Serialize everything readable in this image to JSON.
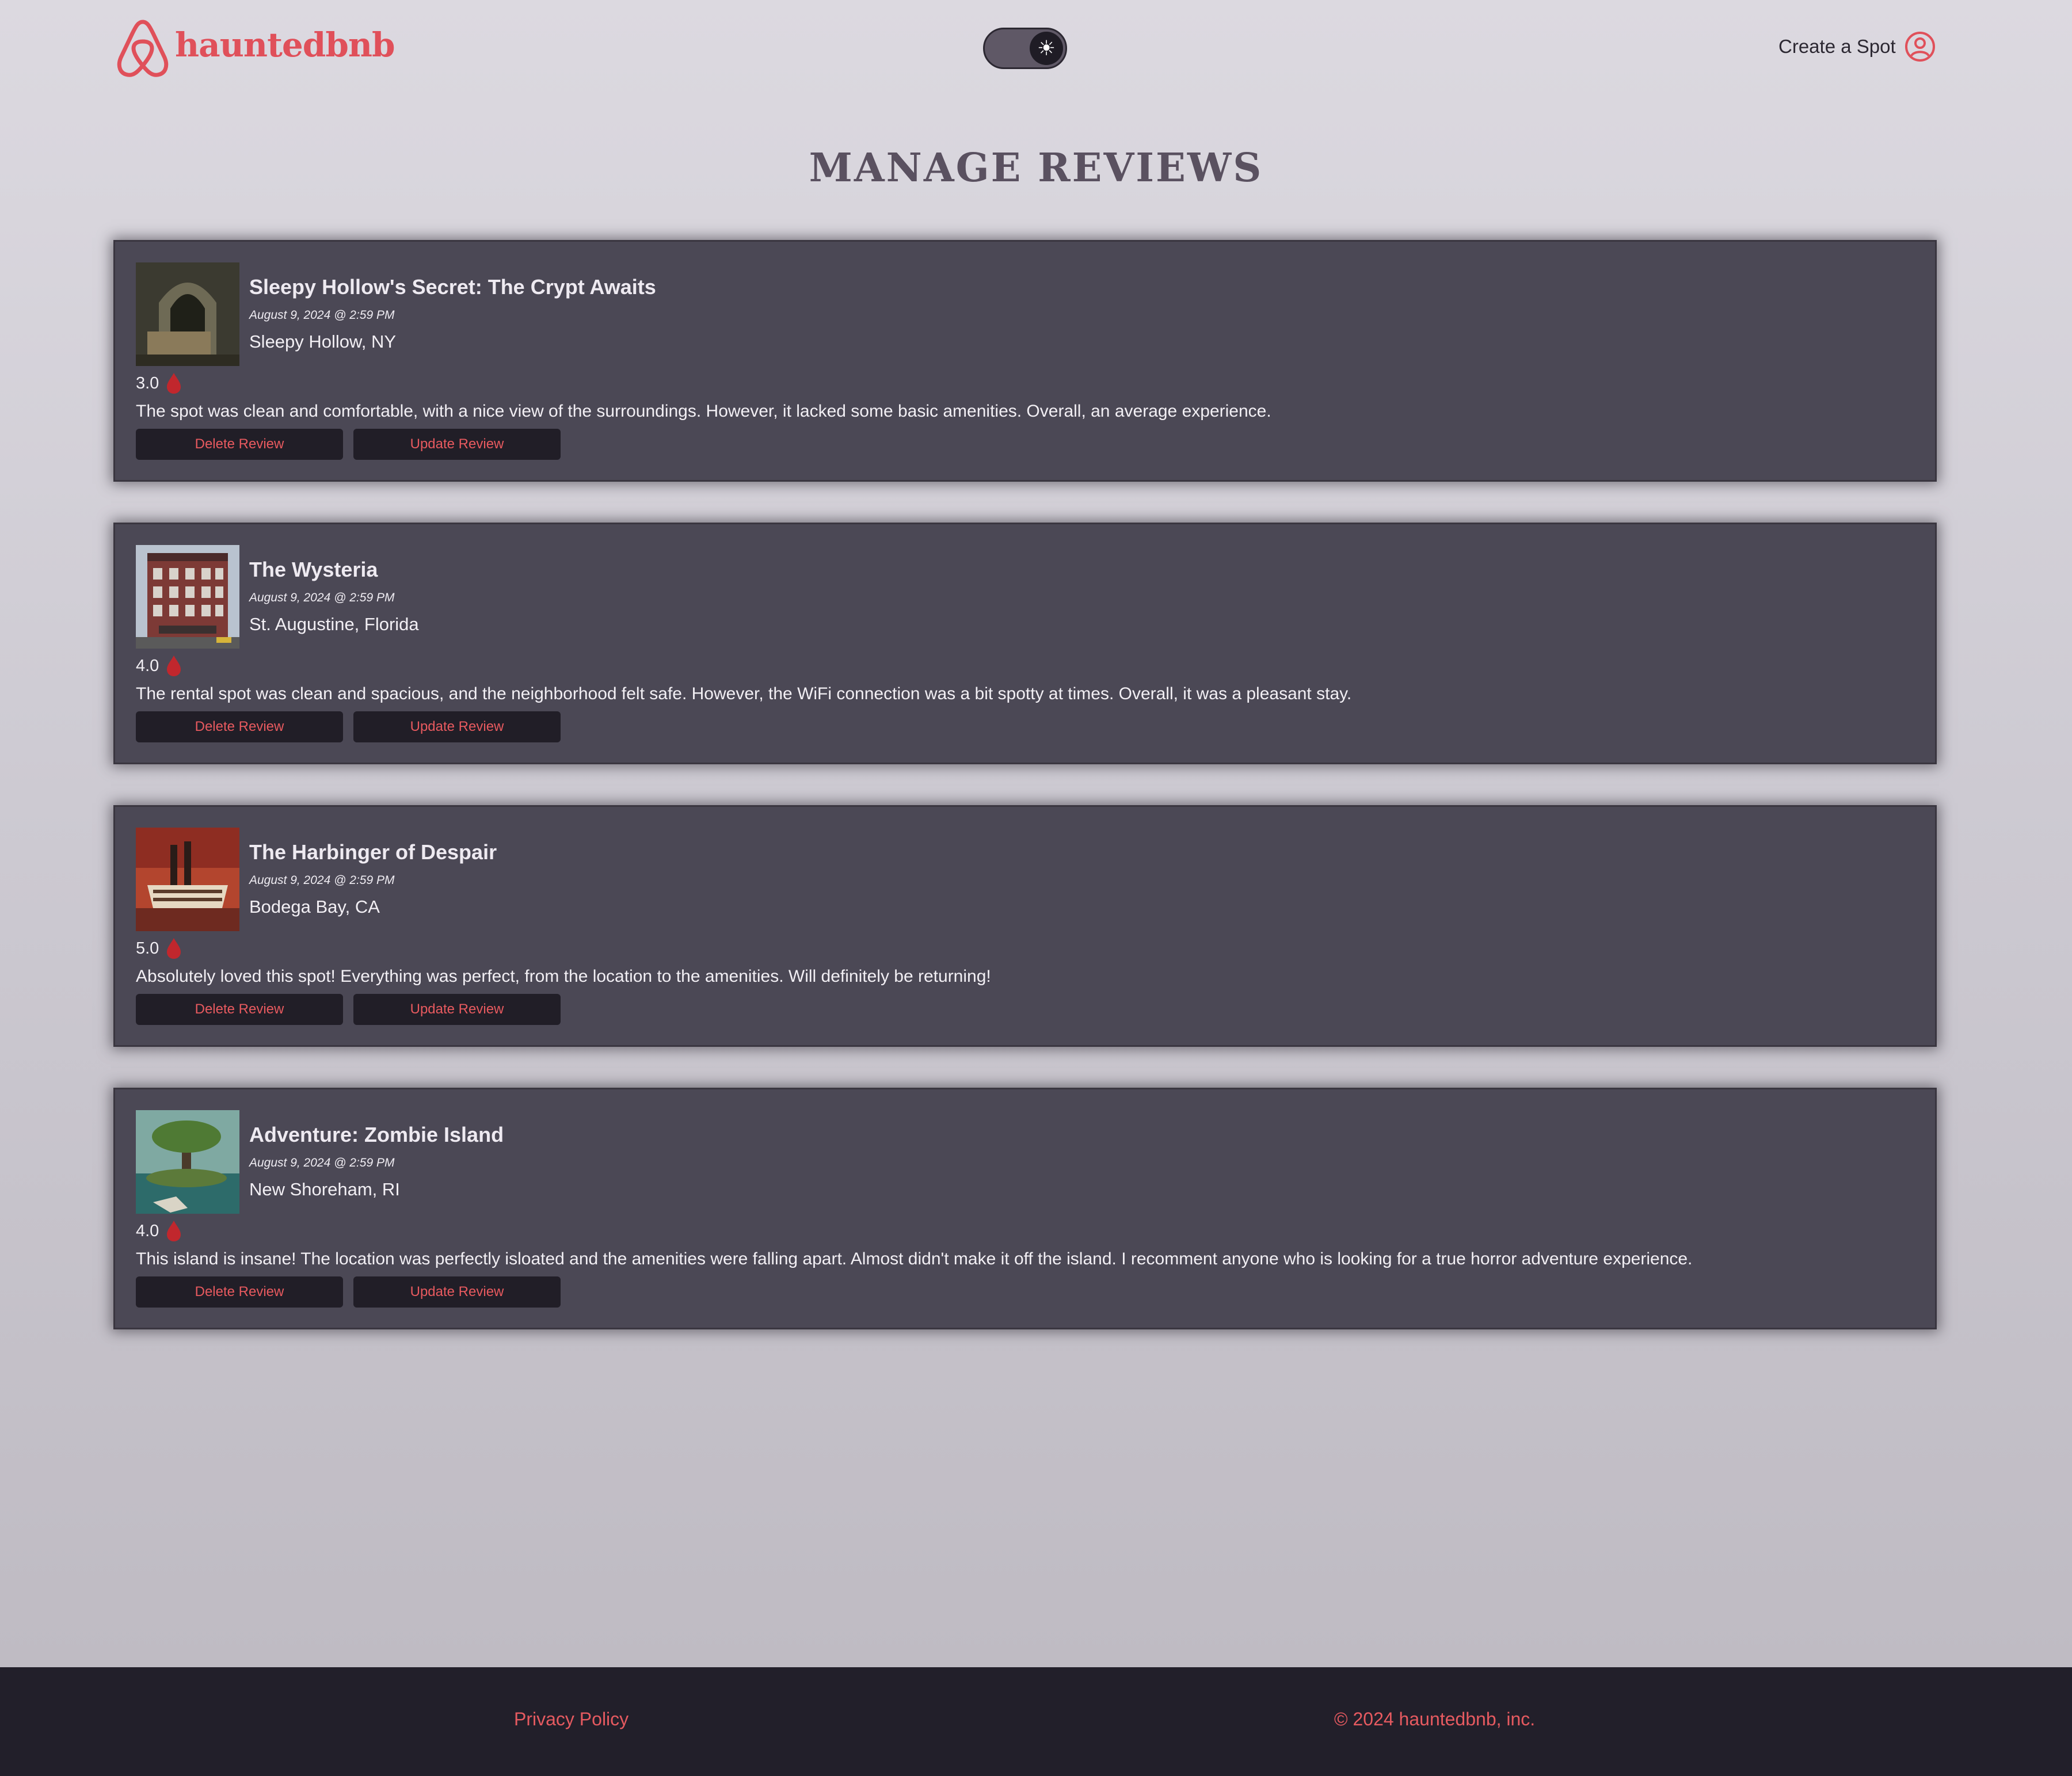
{
  "header": {
    "logo_text": "hauntedbnb",
    "create_spot_label": "Create a Spot",
    "theme_toggle_icon": "sun-icon",
    "profile_icon": "user-circle-icon"
  },
  "page_title": "MANAGE REVIEWS",
  "colors": {
    "accent": "#e85a5f",
    "card_bg": "#4b4855",
    "button_bg": "#211e27",
    "footer_bg": "#221f2a",
    "rating_icon": "#c1272d"
  },
  "reviews": [
    {
      "spot_name": "Sleepy Hollow's Secret: The Crypt Awaits",
      "date": "August 9, 2024 @ 2:59 PM",
      "location": "Sleepy Hollow, NY",
      "rating": "3.0",
      "text": "The spot was clean and comfortable, with a nice view of the surroundings. However, it lacked some basic amenities. Overall, an average experience.",
      "delete_label": "Delete Review",
      "update_label": "Update Review"
    },
    {
      "spot_name": "The Wysteria",
      "date": "August 9, 2024 @ 2:59 PM",
      "location": "St. Augustine, Florida",
      "rating": "4.0",
      "text": "The rental spot was clean and spacious, and the neighborhood felt safe. However, the WiFi connection was a bit spotty at times. Overall, it was a pleasant stay.",
      "delete_label": "Delete Review",
      "update_label": "Update Review"
    },
    {
      "spot_name": "The Harbinger of Despair",
      "date": "August 9, 2024 @ 2:59 PM",
      "location": "Bodega Bay, CA",
      "rating": "5.0",
      "text": "Absolutely loved this spot! Everything was perfect, from the location to the amenities. Will definitely be returning!",
      "delete_label": "Delete Review",
      "update_label": "Update Review"
    },
    {
      "spot_name": "Adventure: Zombie Island",
      "date": "August 9, 2024 @ 2:59 PM",
      "location": "New Shoreham, RI",
      "rating": "4.0",
      "text": "This island is insane! The location was perfectly isloated and the amenities were falling apart. Almost didn't make it off the island. I recomment anyone who is looking for a true horror adventure experience.",
      "delete_label": "Delete Review",
      "update_label": "Update Review"
    }
  ],
  "footer": {
    "privacy_label": "Privacy Policy",
    "copyright": "© 2024 hauntedbnb, inc."
  }
}
